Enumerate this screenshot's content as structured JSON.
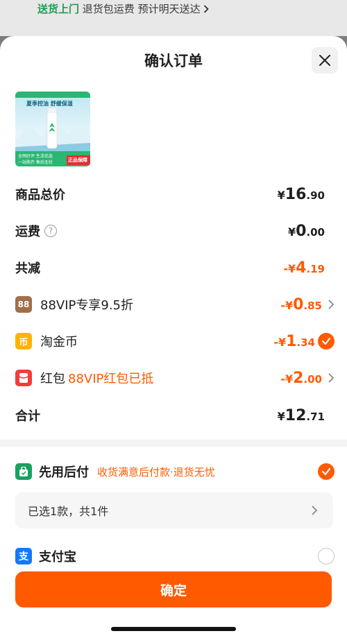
{
  "top_bar": {
    "delivery": "送货上门",
    "return_shipping": "退货包运费",
    "eta": "预计明天送达",
    "chevron": "chevron-right-icon"
  },
  "dialog": {
    "title": "确认订单",
    "close_icon": "close-icon"
  },
  "product": {
    "image_texts": {
      "headline": "夏季控油 舒缓保湿",
      "badge": "正品保障",
      "promo": "一站购齐 售后无忧",
      "rank": "全网好评 生活优选"
    }
  },
  "summary": {
    "goods_total": {
      "label": "商品总价",
      "currency": "¥",
      "int": "16",
      "dec": ".90"
    },
    "shipping": {
      "label": "运费",
      "info_icon": "?",
      "currency": "¥",
      "int": "0",
      "dec": ".00"
    },
    "total_discount": {
      "label": "共减",
      "currency": "-¥",
      "int": "4",
      "dec": ".19"
    },
    "vip": {
      "icon_text": "88",
      "label": "88VIP专享9.5折",
      "currency": "-¥",
      "int": "0",
      "dec": ".85"
    },
    "coins": {
      "icon_text": "币",
      "label": "淘金币",
      "currency": "-¥",
      "int": "1",
      "dec": ".34"
    },
    "redpack": {
      "label": "红包",
      "promo": "88VIP红包已抵",
      "currency": "-¥",
      "int": "2",
      "dec": ".00"
    },
    "grand_total": {
      "label": "合计",
      "currency": "¥",
      "int": "12",
      "dec": ".71"
    }
  },
  "payment": {
    "pay_later": {
      "name": "先用后付",
      "sub": "收货满意后付款·退货无忧"
    },
    "selected": "已选1款，共1件",
    "alipay": {
      "name": "支付宝",
      "icon_text": "支"
    }
  },
  "confirm_button": "确定",
  "colors": {
    "accent": "#ff5a00",
    "green": "#1f9d55",
    "alipay_blue": "#1677ff"
  }
}
